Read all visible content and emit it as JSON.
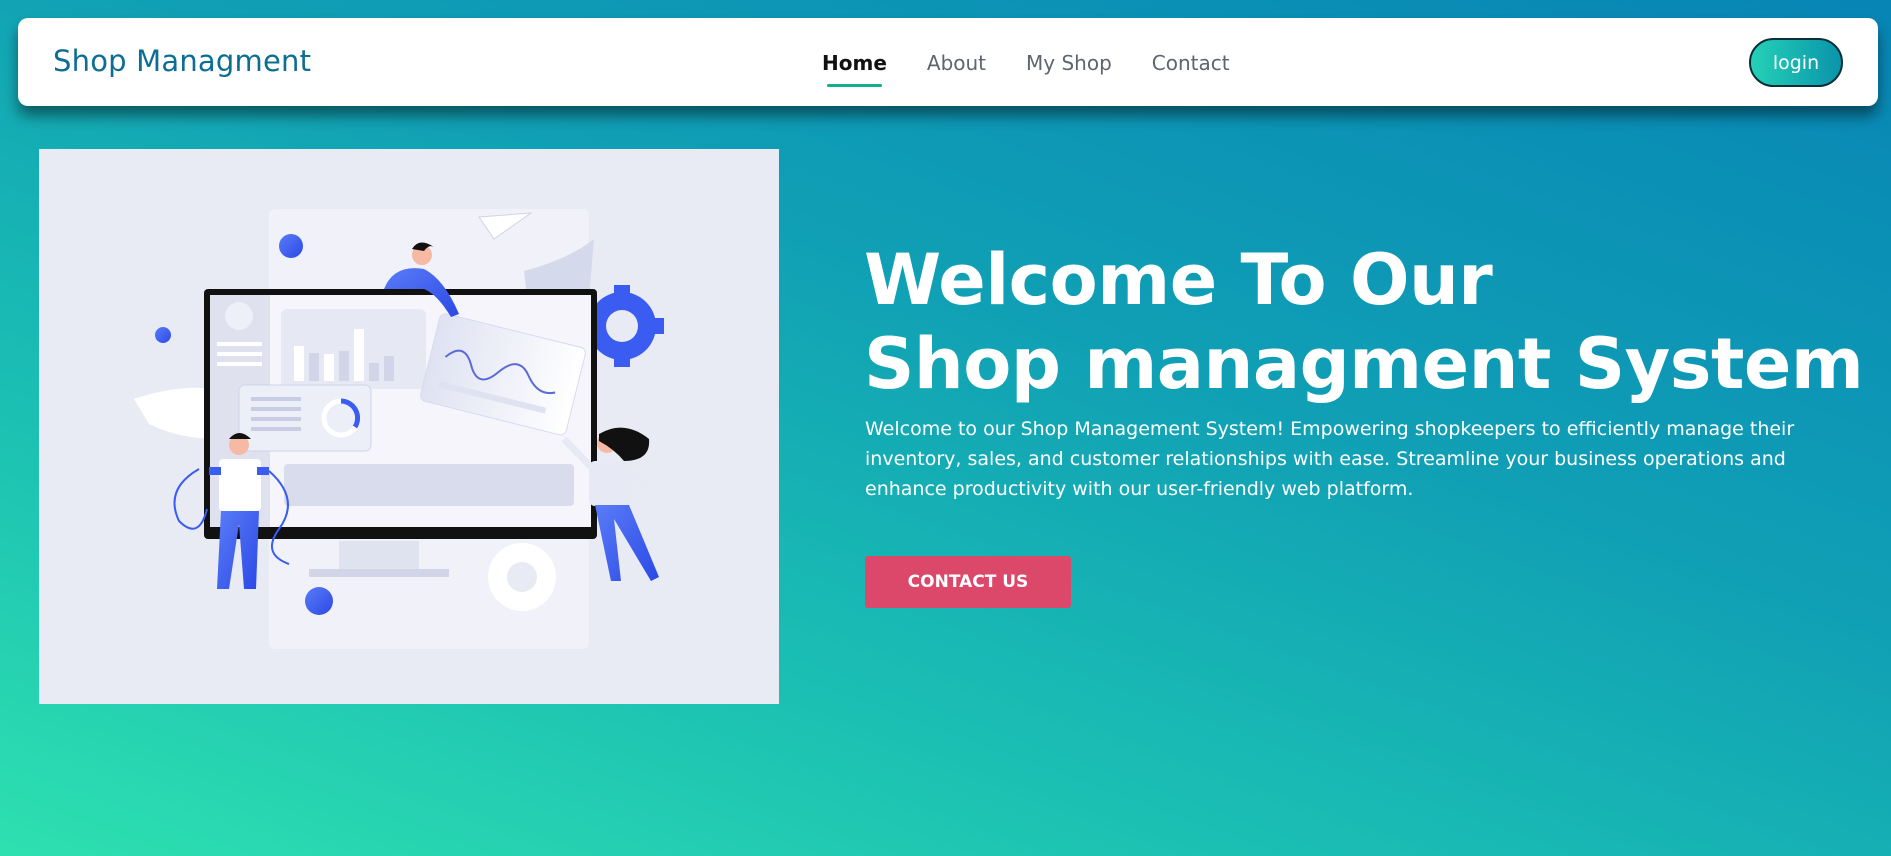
{
  "navbar": {
    "brand": "Shop Managment",
    "links": [
      {
        "label": "Home",
        "active": true
      },
      {
        "label": "About",
        "active": false
      },
      {
        "label": "My Shop",
        "active": false
      },
      {
        "label": "Contact",
        "active": false
      }
    ],
    "login_label": "login"
  },
  "hero": {
    "title_line1": "Welcome To Our",
    "title_line2": "Shop managment System",
    "description": "Welcome to our Shop Management System! Empowering shopkeepers to efficiently manage their inventory, sales, and customer relationships with ease. Streamline your business operations and enhance productivity with our user-friendly web platform.",
    "cta_label": "CONTACT US",
    "illustration": "team-working-on-computer-dashboard-illustration"
  },
  "colors": {
    "brand": "#0d6e93",
    "nav_active_underline": "#10b08a",
    "cta": "#db4869",
    "gradient_start": "#2ee0b0",
    "gradient_end": "#0785b5",
    "illustration_accent": "#3a5cf0"
  }
}
